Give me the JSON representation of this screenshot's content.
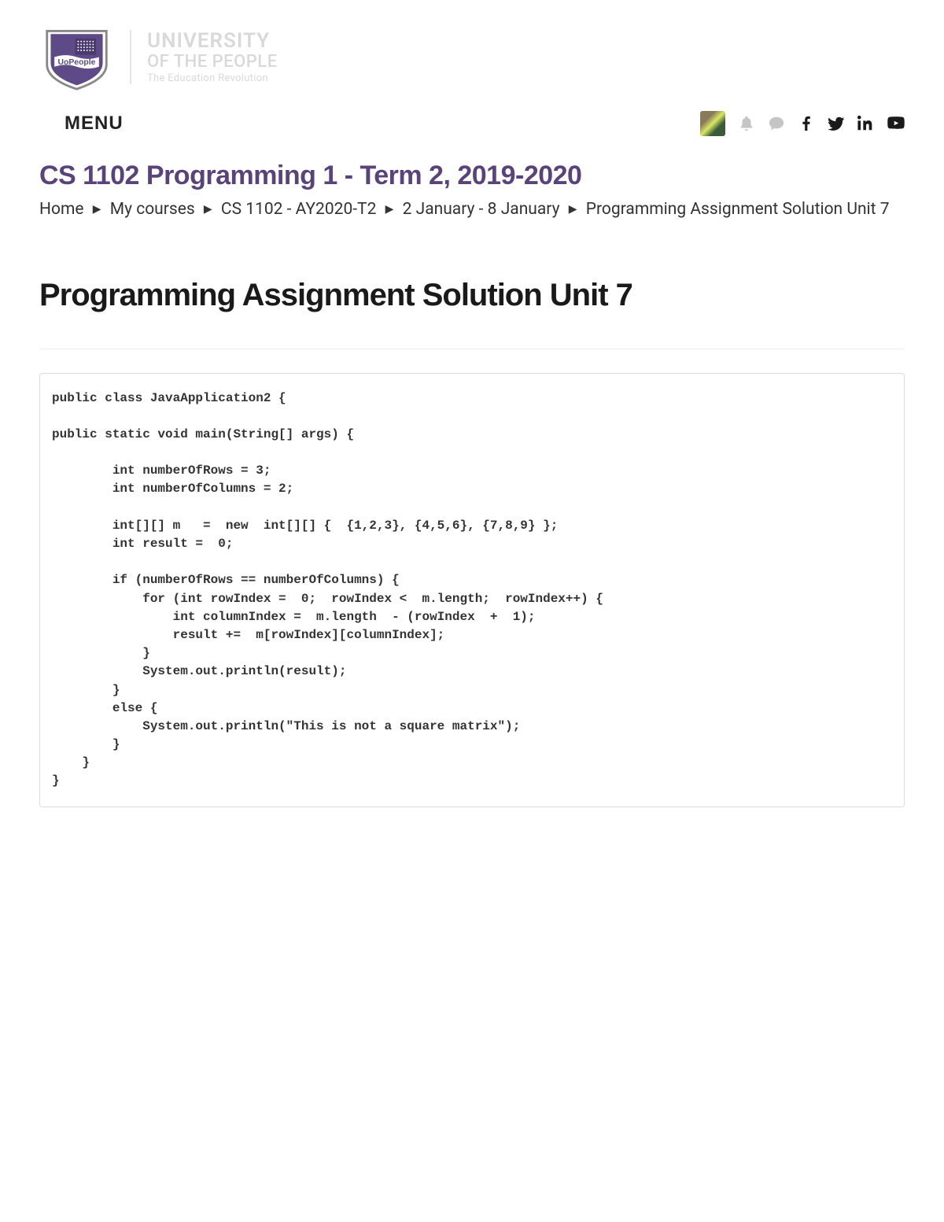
{
  "logo": {
    "line1": "UNIVERSITY",
    "line2": "OF THE PEOPLE",
    "line3": "The Education Revolution",
    "badge_text": "UoPeople"
  },
  "menu_label": "MENU",
  "course_title": "CS 1102 Programming 1 - Term 2, 2019-2020",
  "breadcrumb": {
    "items": [
      "Home",
      "My courses",
      "CS 1102 - AY2020-T2",
      "2 January - 8 January",
      "Programming Assignment Solution Unit 7"
    ]
  },
  "page_title": "Programming Assignment Solution Unit 7",
  "code": "public class JavaApplication2 {\n\npublic static void main(String[] args) {\n\n        int numberOfRows = 3;\n        int numberOfColumns = 2;\n\n        int[][] m   =  new  int[][] {  {1,2,3}, {4,5,6}, {7,8,9} };\n        int result =  0;\n\n        if (numberOfRows == numberOfColumns) {\n            for (int rowIndex =  0;  rowIndex <  m.length;  rowIndex++) {\n                int columnIndex =  m.length  - (rowIndex  +  1);\n                result +=  m[rowIndex][columnIndex];\n            }\n            System.out.println(result);\n        }\n        else {\n            System.out.println(\"This is not a square matrix\");\n        }\n    }\n}"
}
